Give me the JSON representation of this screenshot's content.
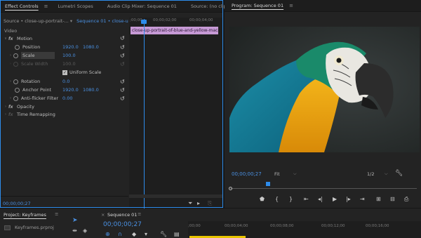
{
  "effect_controls": {
    "tabs": [
      "Effect Controls",
      "Lumetri Scopes",
      "Audio Clip Mixer: Sequence 01",
      "Source: (no clips)"
    ],
    "more_label": "»",
    "source_label": "Source • close-up-portrait-...",
    "sequence_label": "Sequence 01 • close-up...",
    "section_video": "Video",
    "motion_label": "Motion",
    "position_label": "Position",
    "position_x": "1920.0",
    "position_y": "1080.0",
    "scale_label": "Scale",
    "scale_value": "100.0",
    "scale_width_label": "Scale Width",
    "scale_width_value": "100.0",
    "uniform_scale_label": "Uniform Scale",
    "rotation_label": "Rotation",
    "rotation_value": "0.0",
    "anchor_label": "Anchor Point",
    "anchor_x": "1920.0",
    "anchor_y": "1080.0",
    "antiflicker_label": "Anti-flicker Filter",
    "antiflicker_value": "0.00",
    "opacity_label": "Opacity",
    "time_remap_label": "Time Remapping",
    "timecode": "00;00;00;27",
    "ruler_ticks": [
      ";00;00",
      "00;00;02;00",
      "00;00;04;00"
    ],
    "clip_name": "close-up-portrait-of-blue-and-yellow-maca"
  },
  "program": {
    "title": "Program: Sequence 01",
    "timecode": "00;00;00;27",
    "fit_label": "Fit",
    "resolution_label": "1/2"
  },
  "bottom": {
    "project_tab": "Project: Keyframes",
    "project_file": "Keyframes.prproj",
    "sequence_tab": "Sequence 01",
    "timecode": "00;00;00;27",
    "ruler_ticks": [
      ";00;00",
      "00;00;04;00",
      "00;00;08;00",
      "00;00;12;00",
      "00;00;16;00"
    ]
  }
}
